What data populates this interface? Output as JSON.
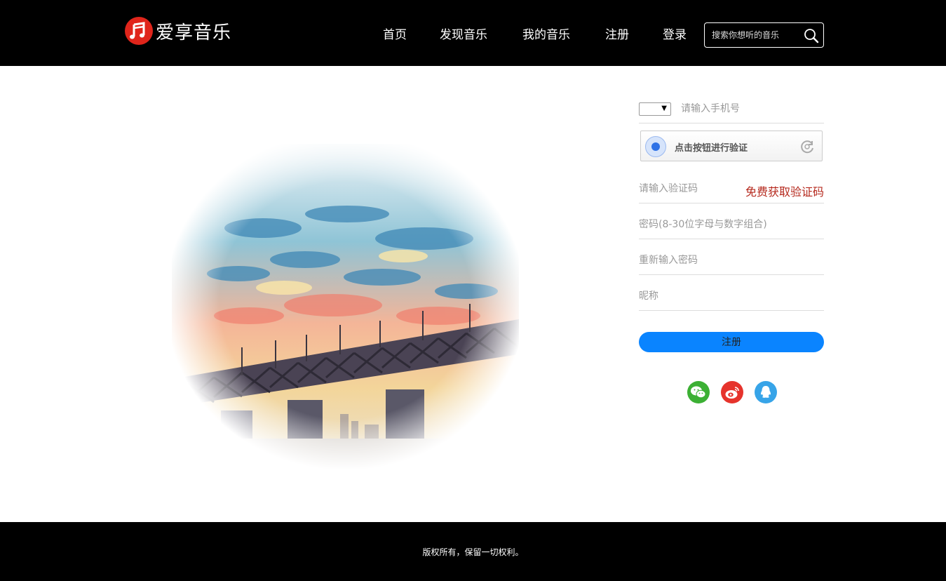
{
  "header": {
    "logo_text": "爱享音乐",
    "nav": [
      {
        "label": "首页"
      },
      {
        "label": "发现音乐"
      },
      {
        "label": "我的音乐"
      },
      {
        "label": "注册"
      },
      {
        "label": "登录"
      }
    ],
    "search_placeholder": "搜索你想听的音乐"
  },
  "form": {
    "phone_placeholder": "请输入手机号",
    "captcha_label": "点击按钮进行验证",
    "code_placeholder": "请输入验证码",
    "get_code_label": "免费获取验证码",
    "password_placeholder": "密码(8-30位字母与数字组合)",
    "repeat_password_placeholder": "重新输入密码",
    "nickname_placeholder": "昵称",
    "register_label": "注册",
    "social": [
      {
        "name": "wechat",
        "color": "#3cb034"
      },
      {
        "name": "weibo",
        "color": "#e6332c"
      },
      {
        "name": "qq",
        "color": "#37a4e8"
      }
    ]
  },
  "footer": {
    "copyright": "版权所有，保留一切权利。"
  },
  "colors": {
    "header_bg": "#000000",
    "brand_red": "#e0251b",
    "accent_blue": "#0a84ff",
    "link_red": "#b5281c"
  }
}
